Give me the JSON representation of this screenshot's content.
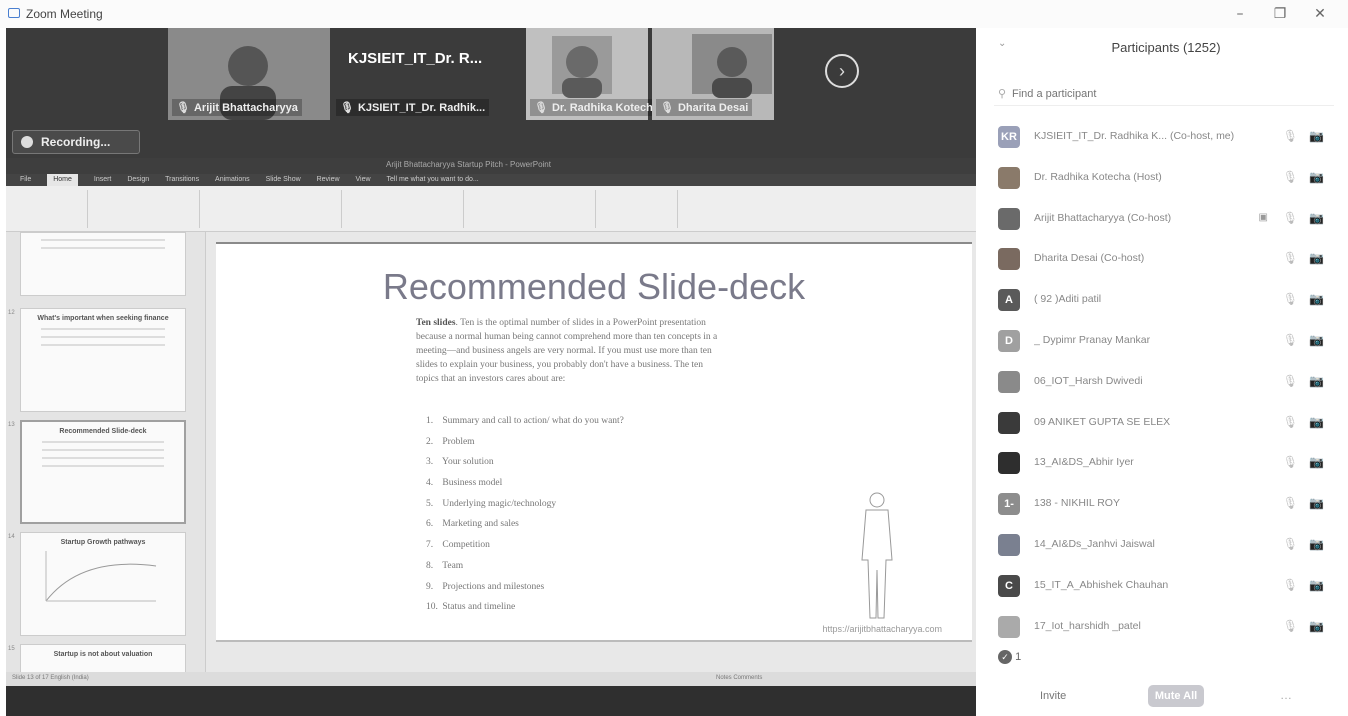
{
  "window": {
    "title": "Zoom Meeting",
    "minimize": "–",
    "restore": "❐",
    "close": "✕"
  },
  "gallery": {
    "tiles": [
      {
        "name": "Arijit Bhattacharyya",
        "type": "video",
        "color": "#8a8a8a"
      },
      {
        "name": "KJSIEIT_IT_Dr. Radhik...",
        "big_label": "KJSIEIT_IT_Dr. R...",
        "type": "name-only",
        "color": "#3b3b3b"
      },
      {
        "name": "Dr. Radhika Kotecha",
        "type": "video",
        "color": "#9a9a9a"
      },
      {
        "name": "Dharita Desai",
        "type": "video",
        "color": "#7a7a7a"
      }
    ],
    "next_icon": "›"
  },
  "recording": {
    "label": "Recording..."
  },
  "ppt": {
    "window_title": "Arijit Bhattacharyya Startup Pitch - PowerPoint",
    "tabs": [
      "File",
      "Home",
      "Insert",
      "Design",
      "Transitions",
      "Animations",
      "Slide Show",
      "Review",
      "View",
      "Tell me what you want to do..."
    ],
    "active_tab": "Home",
    "thumbnails": [
      {
        "num": "",
        "title": ""
      },
      {
        "num": "12",
        "title": "What's important when seeking finance"
      },
      {
        "num": "13",
        "title": "Recommended Slide-deck"
      },
      {
        "num": "14",
        "title": "Startup Growth pathways"
      },
      {
        "num": "15",
        "title": "Startup is not about valuation"
      }
    ],
    "status_left": "Slide 13 of 17    English (India)",
    "status_right": "Notes    Comments"
  },
  "slide": {
    "title": "Recommended Slide-deck",
    "lead": "Ten slides",
    "paragraph": ". Ten is the optimal number of slides in a PowerPoint presentation because a normal human being cannot comprehend more than ten concepts in a meeting—and business angels are very normal. If you must use more than ten slides to explain your business, you probably don't have a business. The ten topics that an investors cares about are:",
    "items": [
      {
        "num": "1.",
        "text": "Summary and call to action/ what do you want?"
      },
      {
        "num": "2.",
        "text": "Problem"
      },
      {
        "num": "3.",
        "text": "Your solution"
      },
      {
        "num": "4.",
        "text": "Business model"
      },
      {
        "num": "5.",
        "text": "Underlying magic/technology"
      },
      {
        "num": "6.",
        "text": "Marketing and sales"
      },
      {
        "num": "7.",
        "text": "Competition"
      },
      {
        "num": "8.",
        "text": "Team"
      },
      {
        "num": "9.",
        "text": "Projections and milestones"
      },
      {
        "num": "10.",
        "text": "Status and timeline"
      }
    ],
    "url": "https://arijitbhattacharyya.com"
  },
  "participants": {
    "title": "Participants (1252)",
    "search_placeholder": "Find a participant",
    "list": [
      {
        "name": "KJSIEIT_IT_Dr. Radhika K... (Co-host, me)",
        "avatar": "KR",
        "avatar_color": "#9aa0b8",
        "extra": "",
        "mic": "🎙",
        "cam": "📷"
      },
      {
        "name": "Dr. Radhika Kotecha (Host)",
        "avatar": "",
        "avatar_color": "#8a7a6a",
        "extra": "",
        "mic": "🎙",
        "cam": "📷"
      },
      {
        "name": "Arijit Bhattacharyya (Co-host)",
        "avatar": "",
        "avatar_color": "#6a6a6a",
        "extra": "▣",
        "mic": "🎙",
        "cam": "📷"
      },
      {
        "name": "Dharita Desai (Co-host)",
        "avatar": "",
        "avatar_color": "#7a6a60",
        "extra": "",
        "mic": "🎙",
        "cam": "📷"
      },
      {
        "name": "( 92 )Aditi patil",
        "avatar": "A",
        "avatar_color": "#5a5a5a",
        "extra": "",
        "mic": "🎙",
        "cam": "📷"
      },
      {
        "name": "_ Dypimr Pranay Mankar",
        "avatar": "D",
        "avatar_color": "#a0a0a0",
        "extra": "",
        "mic": "🎙",
        "cam": "📷"
      },
      {
        "name": "06_IOT_Harsh Dwivedi",
        "avatar": "",
        "avatar_color": "#8a8a8a",
        "extra": "",
        "mic": "🎙",
        "cam": "📷"
      },
      {
        "name": "09 ANIKET GUPTA SE ELEX",
        "avatar": "",
        "avatar_color": "#3a3a3a",
        "extra": "",
        "mic": "🎙",
        "cam": "📷"
      },
      {
        "name": "13_AI&DS_Abhir Iyer",
        "avatar": "",
        "avatar_color": "#2e2e2e",
        "extra": "",
        "mic": "🎙",
        "cam": "📷"
      },
      {
        "name": "138 - NIKHIL ROY",
        "avatar": "1-",
        "avatar_color": "#8d8d8d",
        "extra": "",
        "mic": "🎙",
        "cam": "📷"
      },
      {
        "name": "14_AI&Ds_Janhvi Jaiswal",
        "avatar": "",
        "avatar_color": "#7a8090",
        "extra": "",
        "mic": "🎙",
        "cam": "📷"
      },
      {
        "name": "15_IT_A_Abhishek Chauhan",
        "avatar": "C",
        "avatar_color": "#4a4a4a",
        "extra": "",
        "mic": "🎙",
        "cam": "📷"
      },
      {
        "name": "17_Iot_harshidh _patel",
        "avatar": "",
        "avatar_color": "#aaaaaa",
        "extra": "",
        "mic": "🎙",
        "cam": "📷"
      }
    ],
    "raised_count": "1",
    "invite": "Invite",
    "mute_all": "Mute All",
    "more": "…"
  }
}
